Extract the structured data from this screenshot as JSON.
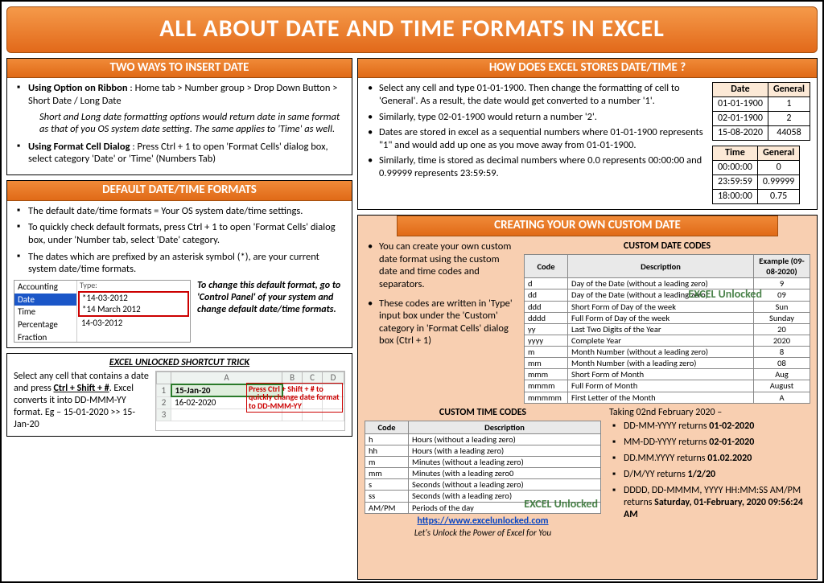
{
  "title": "ALL ABOUT DATE AND TIME FORMATS IN EXCEL",
  "leftCol": {
    "insert": {
      "title": "TWO WAYS TO INSERT DATE",
      "opt1_lead": "Using Option on Ribbon",
      "opt1_rest": " : Home tab > Number group > Drop Down Button > Short Date / Long Date",
      "note": "Short and Long date formatting options would return date in same format as that of you OS system date setting. The same applies to 'Time' as well.",
      "opt2_lead": "Using Format Cell Dialog",
      "opt2_rest": " : Press Ctrl + 1 to open 'Format Cells' dialog box, select category 'Date' or 'Time' (Numbers Tab)"
    },
    "defaults": {
      "title": "DEFAULT DATE/TIME FORMATS",
      "b1": "The default date/time formats = Your OS system date/time settings.",
      "b2": "To quickly check default formats, press Ctrl + 1 to open 'Format Cells' dialog box, under 'Number tab, select 'Date' category.",
      "b3": "The dates which are prefixed by an asterisk symbol (*), are your current system date/time formats.",
      "side": "To change this default format, go to 'Control Panel' of your system and change default date/time formats.",
      "shot": {
        "cats": [
          "Accounting",
          "Date",
          "Time",
          "Percentage",
          "Fraction"
        ],
        "typeLabel": "Type:",
        "items": [
          "*14-03-2012",
          "*14 March 2012",
          "14-03-2012"
        ]
      }
    },
    "trick": {
      "title": "EXCEL UNLOCKED SHORTCUT TRICK",
      "text_pre": "Select any cell that contains a date and press ",
      "shortcut": "Ctrl + Shift + #",
      "text_post": ". Excel converts it into DD-MMM-YY format. Eg – 15-01-2020 >> 15-Jan-20",
      "sheet": {
        "cols": [
          "",
          "A",
          "B",
          "C",
          "D"
        ],
        "r1": [
          "1",
          "15-Jan-20",
          "",
          "",
          ""
        ],
        "r2": [
          "2",
          "16-02-2020",
          "",
          "",
          ""
        ],
        "r3": [
          "3",
          "",
          "",
          "",
          ""
        ]
      },
      "callout": "Press Ctrl + Shift + # to quickly change date format to DD-MMM-YY"
    }
  },
  "rightCol": {
    "store": {
      "title": "HOW DOES EXCEL STORES DATE/TIME ?",
      "b1": "Select any cell and type 01-01-1900. Then change the formatting of cell to 'General'. As a result, the date would get converted to a number '1'.",
      "b2": "Similarly, type 02-01-1900 would return a number '2'.",
      "b3": "Dates are stored in excel as a sequential numbers where 01-01-1900 represents \"1\" and would add up one as you move away from 01-01-1900.",
      "b4": "Similarly, time is stored as decimal numbers where 0.0 represents 00:00:00 and 0.99999 represents 23:59:59.",
      "dateTable": {
        "head": [
          "Date",
          "General"
        ],
        "rows": [
          [
            "01-01-1900",
            "1"
          ],
          [
            "02-01-1900",
            "2"
          ],
          [
            "15-08-2020",
            "44058"
          ]
        ]
      },
      "timeTable": {
        "head": [
          "Time",
          "General"
        ],
        "rows": [
          [
            "00:00:00",
            "0"
          ],
          [
            "23:59:59",
            "0.99999"
          ],
          [
            "18:00:00",
            "0.75"
          ]
        ]
      }
    },
    "custom": {
      "title": "CREATING YOUR OWN CUSTOM DATE",
      "p1": "You can create your own custom date format using the custom date and time codes and separators.",
      "p2": "These codes are written in 'Type' input box under the 'Custom' category in 'Format Cells' dialog box (Ctrl + 1)",
      "dateCodes": {
        "title": "CUSTOM DATE CODES",
        "head": [
          "Code",
          "Description",
          "Example (09-08-2020)"
        ],
        "rows": [
          [
            "d",
            "Day of the Date (without a leading zero)",
            "9"
          ],
          [
            "dd",
            "Day of the Date (without a leading zero)",
            "09"
          ],
          [
            "ddd",
            "Short Form of Day of the week",
            "Sun"
          ],
          [
            "dddd",
            "Full Form of Day of the week",
            "Sunday"
          ],
          [
            "yy",
            "Last Two Digits of the Year",
            "20"
          ],
          [
            "yyyy",
            "Complete Year",
            "2020"
          ],
          [
            "m",
            "Month Number (without a leading zero)",
            "8"
          ],
          [
            "mm",
            "Month Number (with a leading zero)",
            "08"
          ],
          [
            "mmm",
            "Short Form of Month",
            "Aug"
          ],
          [
            "mmmm",
            "Full Form of Month",
            "August"
          ],
          [
            "mmmmm",
            "First Letter of the Month",
            "A"
          ]
        ]
      },
      "timeCodes": {
        "title": "CUSTOM TIME CODES",
        "head": [
          "Code",
          "Description"
        ],
        "rows": [
          [
            "h",
            "Hours (without a leading zero)"
          ],
          [
            "hh",
            "Hours (with a leading zero)"
          ],
          [
            "m",
            "Minutes (without a leading zero)"
          ],
          [
            "mm",
            "Minutes (with a leading zero0"
          ],
          [
            "s",
            "Seconds (without a leading zero)"
          ],
          [
            "ss",
            "Seconds (with a leading zero)"
          ],
          [
            "AM/PM",
            "Periods of the day"
          ]
        ]
      },
      "examples": {
        "lead": "Taking 02nd February 2020 –",
        "r1a": "DD-MM-YYYY returns ",
        "r1b": "01-02-2020",
        "r2a": "MM-DD-YYYY returns ",
        "r2b": "02-01-2020",
        "r3a": "DD.MM.YYYY returns ",
        "r3b": "01.02.2020",
        "r4a": "D/M/YY returns ",
        "r4b": "1/2/20",
        "r5a": "DDDD, DD-MMMM, YYYY HH:MM:SS AM/PM returns ",
        "r5b": "Saturday, 01-February, 2020 09:56:24 AM"
      },
      "link": "https://www.excelunlocked.com",
      "tagline": "Let's Unlock the Power of Excel for You"
    }
  },
  "watermark": "EXCEL Unlocked"
}
